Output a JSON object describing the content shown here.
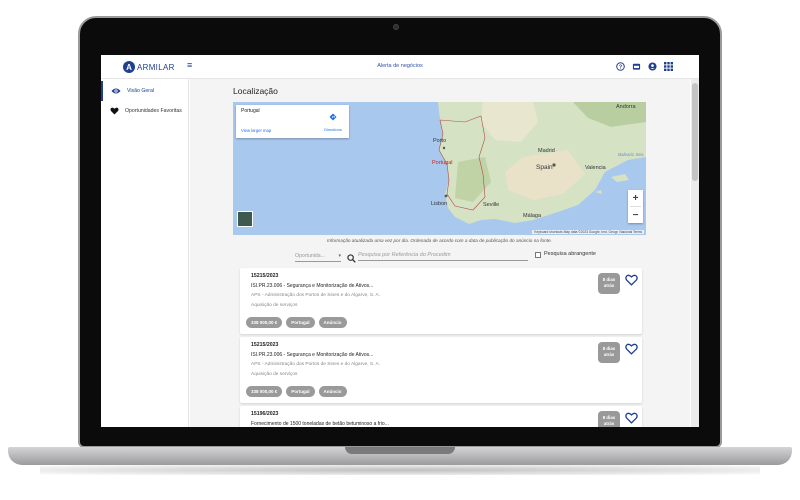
{
  "brand": {
    "name": "ARMILAR",
    "accent": "#1f3f8f"
  },
  "topbar": {
    "title": "Alerta de negócios",
    "icons": [
      "help-icon",
      "store-icon",
      "account-icon",
      "apps-grid-icon"
    ]
  },
  "sidebar": {
    "items": [
      {
        "label": "Visão Geral",
        "icon": "eye-icon",
        "active": true
      },
      {
        "label": "Oportunidades Favoritas",
        "icon": "heart-icon",
        "active": false
      }
    ]
  },
  "main": {
    "section_title": "Localização",
    "map": {
      "place_name": "Portugal",
      "view_larger": "View larger map",
      "directions": "Directions",
      "labels": {
        "portugal": "Portugal",
        "spain": "Spain",
        "madrid": "Madrid",
        "lisbon": "Lisbon",
        "porto": "Porto",
        "andorra": "Andorra",
        "valencia": "Valencia",
        "seville": "Seville",
        "malaga": "Málaga",
        "sea": "Balearic Sea"
      },
      "footer": "Keyboard shortcuts   Map data ©2023 Google, Inst. Geogr. Nacional   Terms"
    },
    "note": "Informação atualizada uma vez por dia. Ordenada de acordo com a data de publicação do anúncio na fonte.",
    "filters": {
      "select_placeholder": "Oportunida...",
      "search_placeholder": "Pesquisa por Referência do Procedim",
      "broad_search_label": "Pesquisa abrangente"
    },
    "cards": [
      {
        "ref": "15215/2023",
        "title": "ISI.PR.23.006 - Segurança e Monitorização de Ativos...",
        "entity": "APS - Administração dos Portos de Sines e do Algarve, S. A.",
        "type": "Aquisição de serviços",
        "chips": [
          "338 000,00 €",
          "Portugal",
          "Anúncio"
        ],
        "days": "8 dias atrás"
      },
      {
        "ref": "15215/2023",
        "title": "ISI.PR.23.006 - Segurança e Monitorização de Ativos...",
        "entity": "APS - Administração dos Portos de Sines e do Algarve, S. A.",
        "type": "Aquisição de serviços",
        "chips": [
          "338 000,00 €",
          "Portugal",
          "Anúncio"
        ],
        "days": "8 dias atrás"
      },
      {
        "ref": "15196/2023",
        "title": "Fornecimento de 1500 toneladas de betão betuminoso a frio...",
        "entity": "",
        "type": "",
        "chips": [],
        "days": "8 dias atrás"
      }
    ]
  }
}
